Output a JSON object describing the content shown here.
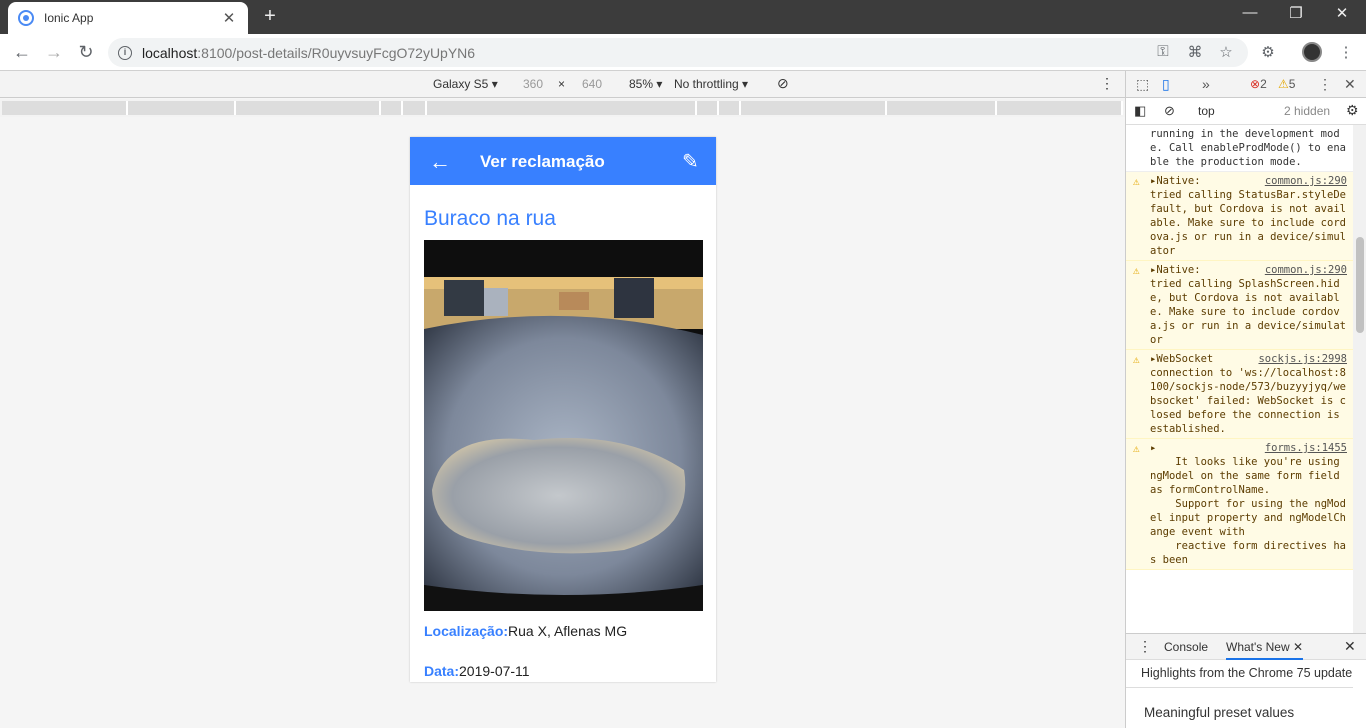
{
  "browser": {
    "tab_title": "Ionic App",
    "url_host": "localhost",
    "url_path": ":8100/post-details/R0uyvsuyFcgO72yUpYN6"
  },
  "device_toolbar": {
    "device": "Galaxy S5",
    "width": "360",
    "height": "640",
    "zoom": "85%",
    "throttling": "No throttling"
  },
  "app": {
    "header_title": "Ver reclamação",
    "post_title": "Buraco na rua",
    "location_label": "Localização:",
    "location_value": "Rua X, Aflenas MG",
    "date_label": "Data:",
    "date_value": "2019-07-11"
  },
  "devtools": {
    "error_count": "2",
    "warning_count": "5",
    "context": "top",
    "hidden": "2 hidden",
    "messages": [
      {
        "type": "info",
        "text": "running in the development mode. Call enableProdMode() to enable the production mode.",
        "source": ""
      },
      {
        "type": "warn",
        "text": "tried calling StatusBar.styleDefault, but Cordova is not available. Make sure to include cordova.js or run in a device/simulator",
        "prefix": "▸Native:",
        "source": "common.js:290"
      },
      {
        "type": "warn",
        "text": "tried calling SplashScreen.hide, but Cordova is not available. Make sure to include cordova.js or run in a device/simulator",
        "prefix": "▸Native:",
        "source": "common.js:290"
      },
      {
        "type": "warn",
        "text": "connection to 'ws://localhost:8100/sockjs-node/573/buzyyjyq/websocket' failed: WebSocket is closed before the connection is established.",
        "prefix": "▸WebSocket",
        "source": "sockjs.js:2998"
      },
      {
        "type": "warn",
        "text": "    It looks like you're using ngModel on the same form field as formControlName.\n    Support for using the ngModel input property and ngModelChange event with\n    reactive form directives has been",
        "prefix": "▸",
        "source": "forms.js:1455"
      }
    ],
    "drawer_tabs": [
      "Console",
      "What's New"
    ],
    "drawer_heading": "Highlights from the Chrome 75 update",
    "drawer_item": "Meaningful preset values"
  }
}
